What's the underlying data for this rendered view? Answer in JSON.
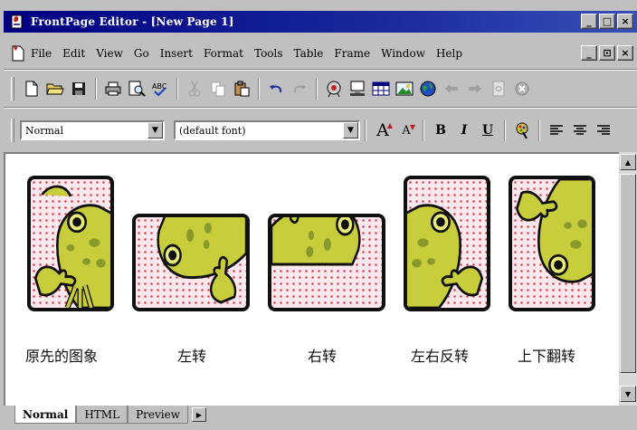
{
  "window": {
    "title": "FrontPage Editor - [New Page 1]",
    "controls": [
      "_",
      "□",
      "×"
    ],
    "doc_controls": [
      "_",
      "⊡",
      "×"
    ]
  },
  "menu": {
    "items": [
      "File",
      "Edit",
      "View",
      "Go",
      "Insert",
      "Format",
      "Tools",
      "Table",
      "Frame",
      "Window",
      "Help"
    ]
  },
  "toolbar": {
    "style_value": "Normal",
    "font_value": "(default font)",
    "bold": "B",
    "italic": "I",
    "underline": "U",
    "grow_font": "A",
    "shrink_font": "A"
  },
  "images": {
    "captions": [
      "原先的图象",
      "左转",
      "右转",
      "左右反转",
      "上下翻转"
    ]
  },
  "tabs": {
    "items": [
      "Normal",
      "HTML",
      "Preview"
    ],
    "active": "Normal"
  },
  "colors": {
    "title_bar": "#000080",
    "frog_body": "#c8cd3c",
    "frog_spots": "#8a9a2a",
    "frog_outline": "#101010",
    "card_background": "#fde8ee",
    "card_dots": "#d23c4a"
  }
}
